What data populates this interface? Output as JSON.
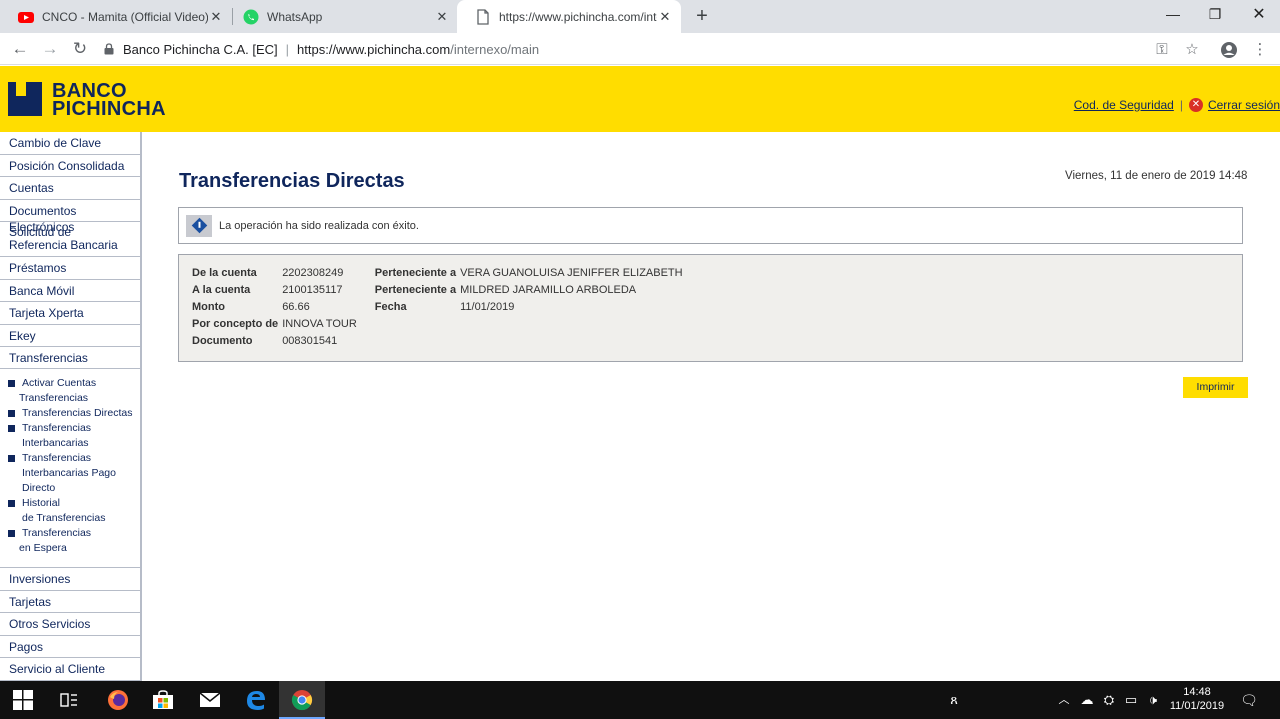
{
  "browser": {
    "tabs": [
      {
        "title": "CNCO - Mamita (Official Video) -",
        "icon": "youtube-icon"
      },
      {
        "title": "WhatsApp",
        "icon": "whatsapp-icon"
      },
      {
        "title": "https://www.pichincha.com/inter",
        "icon": "page-icon"
      }
    ],
    "address": {
      "site_name": "Banco Pichincha C.A. [EC]",
      "divider": "|",
      "host": "https://www.pichincha.com",
      "path": "/internexo/main"
    }
  },
  "header": {
    "logo_line1": "BANCO",
    "logo_line2": "PICHINCHA",
    "security_code_link": "Cod. de Seguridad",
    "separator": "|",
    "logout_link": "Cerrar sesión"
  },
  "sidebar": {
    "items_top": [
      {
        "label": "Cambio de Clave"
      },
      {
        "label": "Posición Consolidada"
      },
      {
        "label": "Cuentas"
      },
      {
        "label": "Documentos Electrónicos"
      },
      {
        "label1": "Solicitud de",
        "label2": "Referencia Bancaria"
      },
      {
        "label": "Préstamos"
      },
      {
        "label": "Banca Móvil"
      },
      {
        "label": "Tarjeta Xperta"
      },
      {
        "label": "Ekey"
      },
      {
        "label": "Transferencias"
      }
    ],
    "submenu": [
      {
        "line1": "Activar Cuentas",
        "line2": "Transferencias"
      },
      {
        "line1": "Transferencias Directas"
      },
      {
        "line1": "Transferencias",
        "line2": "Interbancarias"
      },
      {
        "line1": "Transferencias",
        "line2": "Interbancarias Pago",
        "line3": "Directo"
      },
      {
        "line1": "Historial",
        "line2": "de Transferencias"
      },
      {
        "line1": "Transferencias",
        "line2": "en Espera"
      }
    ],
    "items_bottom": [
      {
        "label": "Inversiones"
      },
      {
        "label": "Tarjetas"
      },
      {
        "label": "Otros Servicios"
      },
      {
        "label": "Pagos"
      },
      {
        "label": "Servicio al Cliente"
      }
    ]
  },
  "main": {
    "title": "Transferencias Directas",
    "datetime": "Viernes, 11 de enero de 2019 14:48",
    "message": "La operación ha sido realizada con éxito.",
    "details": {
      "from_account_label": "De la cuenta",
      "from_account_value": "2202308249",
      "from_owner_label": "Perteneciente a",
      "from_owner_value": "VERA GUANOLUISA JENIFFER ELIZABETH",
      "to_account_label": "A la cuenta",
      "to_account_value": "2100135117",
      "to_owner_label": "Perteneciente a",
      "to_owner_value": "MILDRED JARAMILLO ARBOLEDA",
      "amount_label": "Monto",
      "amount_value": "66.66",
      "date_label": "Fecha",
      "date_value": "11/01/2019",
      "concept_label": "Por concepto de",
      "concept_value": "INNOVA TOUR",
      "document_label": "Documento",
      "document_value": "008301541"
    },
    "print_button": "Imprimir"
  },
  "taskbar": {
    "time": "14:48",
    "date": "11/01/2019"
  }
}
